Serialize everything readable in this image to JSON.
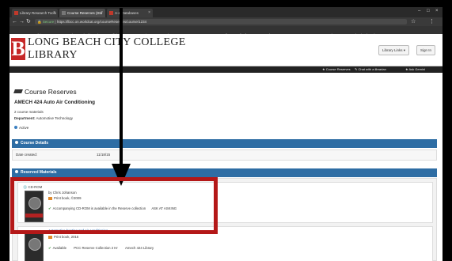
{
  "browser": {
    "tabs": [
      {
        "label": "Library Research Tools"
      },
      {
        "label": "Course Reserves (Stu"
      },
      {
        "label": "A-Z Databases"
      }
    ],
    "url": {
      "secure_label": "Secure",
      "value": "https://lbcc.on.worldcat.org/courseReserves/course/1234"
    },
    "bookmarks": [
      "Apps",
      "Wiki",
      "OR Campus Ed",
      "Blackboard",
      "Starfish",
      "LBCC",
      "Jigsaw",
      "Webcat",
      "LLAM",
      "OCLC",
      "Moodle",
      "Lib of Cong",
      "Bookstore",
      "BI",
      "NWN",
      "LBCC Student Lou",
      "Other bookmarks"
    ]
  },
  "site": {
    "logo_letter": "B",
    "logo_line1": "LONG BEACH CITY COLLEGE",
    "logo_line2": "LIBRARY",
    "library_links_label": "Library Links",
    "sign_in_label": "Sign In",
    "nav_links": [
      "Course Reserves",
      "Chat with a librarian",
      "Ask Gemini"
    ]
  },
  "course": {
    "section_title": "Course Reserves",
    "title": "AMECH 424 Auto Air Conditioning",
    "materials_count": "2 course materials",
    "department_label": "Department:",
    "department_value": "Automotive Technology",
    "status": "Active"
  },
  "course_details": {
    "heading": "Course Details",
    "date_label": "Date created:",
    "date_value": "11/18/15"
  },
  "reserved_materials": {
    "heading": "Reserved Materials",
    "items": [
      {
        "media_label": "CD-ROM",
        "author_prefix": "by",
        "author": "Chris Johanson",
        "print_label": "Print book, ©2009",
        "availability": "Accompanying CD-ROM is available in the Reserve collection",
        "call_number": "ASK AT ASKING"
      },
      {
        "title": "Automotive heating and air conditioning",
        "print_label": "Print book, 2015",
        "availability": "Available",
        "location": "PCC Reserve Collection 2 Hr",
        "call_number": "Amech 424 Library"
      }
    ]
  }
}
